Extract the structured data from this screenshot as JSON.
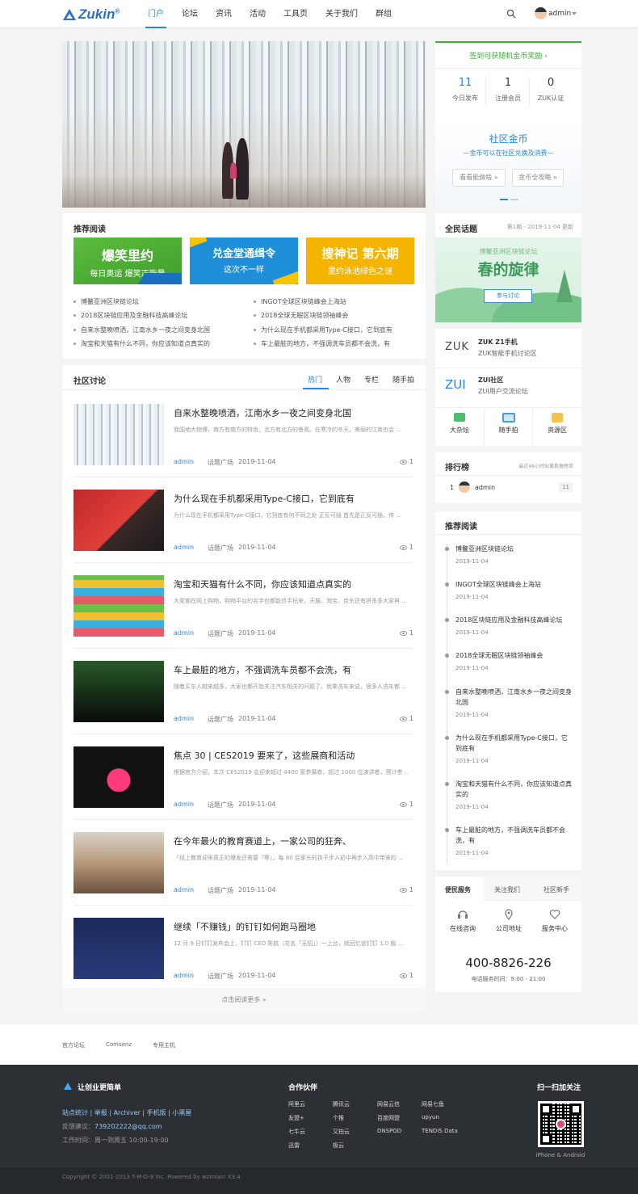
{
  "header": {
    "logo": "Zukin",
    "logo_mark": "®",
    "nav": [
      "门户",
      "论坛",
      "资讯",
      "活动",
      "工具页",
      "关于我们",
      "群组"
    ],
    "user": "admin"
  },
  "sign": {
    "link": "签到可获随机金币奖励 ›",
    "stats": [
      {
        "value": "11",
        "label": "今日发布"
      },
      {
        "value": "1",
        "label": "注册会员"
      },
      {
        "value": "0",
        "label": "ZUK认证"
      }
    ],
    "coin_title": "社区金币",
    "coin_sub": "—金币可以在社区兑换及消费—",
    "btn1": "看看能做啥 »",
    "btn2": "金币全攻略 »"
  },
  "recommend": {
    "title": "推荐阅读",
    "banners": [
      {
        "line1": "爆笑里约",
        "line2": "每日奥运  爆笑正能量",
        "color": "#4cae3a"
      },
      {
        "line1": "兑金堂通缉令",
        "line2": "这次不一样",
        "color": "#1e8fd8"
      },
      {
        "line1": "搜神记 第六期",
        "line2": "里约泳池绿色之谜",
        "color": "#f4b400"
      }
    ],
    "left": [
      "博鳌亚洲区块链论坛",
      "2018区块链应用及金融科技高峰论坛",
      "自来水整晚喷洒，江南水乡一夜之间变身北国",
      "淘宝和天猫有什么不同，你应该知道点真实的"
    ],
    "right": [
      "INGOT全球区块链峰会上海站",
      "2018全球无眠区块链领袖峰会",
      "为什么现在手机都采用Type-C接口，它到底有",
      "车上最脏的地方，不强调洗车员都不会洗，有"
    ]
  },
  "discussion": {
    "title": "社区讨论",
    "tabs": [
      "热门",
      "人物",
      "专栏",
      "随手拍"
    ],
    "items": [
      {
        "title": "自来水整晚喷洒，江南水乡一夜之间变身北国",
        "desc": "我国地大物博，南方有南方的特色，北方有北方的景观。在寒冷的冬天，美丽的江南也会 ...",
        "author": "admin",
        "forum": "话题广场",
        "date": "2019-11-04",
        "views": "1"
      },
      {
        "title": "为什么现在手机都采用Type-C接口，它到底有",
        "desc": "为什么现在手机都采用Type-C接口，它到底有何不同之处 正反可插 首先是正反可插，传 ...",
        "author": "admin",
        "forum": "话题广场",
        "date": "2019-11-04",
        "views": "1"
      },
      {
        "title": "淘宝和天猫有什么不同，你应该知道点真实的",
        "desc": "大家都在网上购物，购物平台的名字也都能信手拈来，天猫、淘宝、京东还有拼多多大家再 ...",
        "author": "admin",
        "forum": "话题广场",
        "date": "2019-11-04",
        "views": "1"
      },
      {
        "title": "车上最脏的地方，不强调洗车员都不会洗，有",
        "desc": "随着买车人越来越多，大家也都开始关注汽车相关的问题了。就拿洗车来说，很多人洗车都 ...",
        "author": "admin",
        "forum": "话题广场",
        "date": "2019-11-04",
        "views": "1"
      },
      {
        "title": "焦点 30 | CES2019 要来了，这些展商和活动",
        "desc": "根据官方介绍，本次 CES2019 会迎来超过 4400 家参展商，超过 1000 位演讲者，预计参 ...",
        "author": "admin",
        "forum": "话题广场",
        "date": "2019-11-04",
        "views": "1"
      },
      {
        "title": "在今年最火的教育赛道上，一家公司的狂奔、",
        "desc": "「线上教育迎来真正的爆发还需要『等』，每 80 后家长的孩子步入初中再步入高中带来的 ...",
        "author": "admin",
        "forum": "话题广场",
        "date": "2019-11-04",
        "views": "1"
      },
      {
        "title": "继续「不赚钱」的钉钉如何跑马圈地",
        "desc": "12 月 9 日钉钉发布会上，钉钉 CEO 陈航（花名「无招」）一上台，就回忆道钉钉 1.0 版 ...",
        "author": "admin",
        "forum": "话题广场",
        "date": "2019-11-04",
        "views": "1"
      }
    ],
    "more": "点击阅读更多 »"
  },
  "topic": {
    "title": "全民话题",
    "issue": "第1期 - 2019-11-04 更新",
    "banner_small": "博鳌亚洲区块链论坛",
    "banner_big": "春的旋律",
    "banner_btn": "参与讨论"
  },
  "forums": [
    {
      "logo": "ZUK",
      "name": "ZUK Z1手机",
      "desc": "ZUK智能手机讨论区"
    },
    {
      "logo": "ZUI",
      "name": "ZUI社区",
      "desc": "ZUI用户交流论坛"
    }
  ],
  "shortcuts": [
    "大杂烩",
    "随手拍",
    "资源区"
  ],
  "rank": {
    "title": "排行榜",
    "note": "最近48小时贴量数据榜单",
    "items": [
      {
        "n": "1",
        "name": "admin",
        "count": "11"
      }
    ]
  },
  "side_reads": {
    "title": "推荐阅读",
    "items": [
      {
        "t": "博鳌亚洲区块链论坛",
        "d": "2019-11-04"
      },
      {
        "t": "INGOT全球区块链峰会上海站",
        "d": "2019-11-04"
      },
      {
        "t": "2018区块链应用及金融科技高峰论坛",
        "d": "2019-11-04"
      },
      {
        "t": "2018全球无眠区块链领袖峰会",
        "d": "2019-11-04"
      },
      {
        "t": "自来水整晚喷洒，江南水乡一夜之间变身北国",
        "d": "2019-11-04"
      },
      {
        "t": "为什么现在手机都采用Type-C接口，它到底有",
        "d": "2019-11-04"
      },
      {
        "t": "淘宝和天猫有什么不同，你应该知道点真实的",
        "d": "2019-11-04"
      },
      {
        "t": "车上最脏的地方，不强调洗车员都不会洗，有",
        "d": "2019-11-04"
      }
    ]
  },
  "service": {
    "tabs": [
      "便民服务",
      "关注我们",
      "社区新手"
    ],
    "items": [
      "在线咨询",
      "公司地址",
      "服务中心"
    ],
    "phone": "400-8826-226",
    "hours": "电话服务时间：9:00 - 21:00"
  },
  "friend_links": [
    "官方论坛",
    "Comsenz",
    "专用主机"
  ],
  "footer": {
    "brand": "让创业更简单",
    "links": [
      "站点统计",
      "举报",
      "Archiver",
      "手机版",
      "小黑屋"
    ],
    "feedback_label": "反馈建议：",
    "feedback_email": "739202222@qq.com",
    "hours": "工作时间：周一到周五 10:00-19:00",
    "partners_title": "合作伙伴",
    "partners": [
      "阿里云",
      "腾讯云",
      "网易云信",
      "网易七鱼",
      "友盟+",
      "个推",
      "百度网盟",
      "upyun",
      "七牛云",
      "又拍云",
      "DNSPOD",
      "TENDIS Data",
      "迅雷",
      "极云"
    ],
    "qr_title": "扫一扫加关注",
    "qr_caption": "iPhone & Android",
    "copyright": "Copyright © 2001-2013 T-M-D-9 Inc.  Powered by wzmiao! X3.4"
  },
  "colors": {
    "accent": "#2b85e4",
    "green": "#3cb034",
    "footer_bg": "#2c2f33"
  }
}
